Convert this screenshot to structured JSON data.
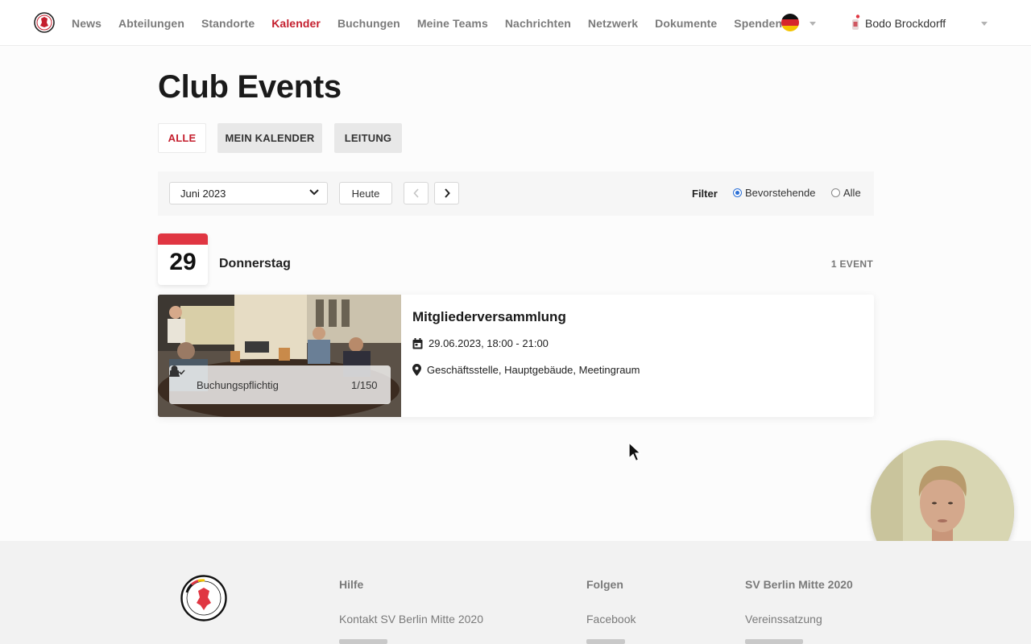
{
  "nav": {
    "items": [
      {
        "label": "News",
        "active": false
      },
      {
        "label": "Abteilungen",
        "active": false
      },
      {
        "label": "Standorte",
        "active": false
      },
      {
        "label": "Kalender",
        "active": true
      },
      {
        "label": "Buchungen",
        "active": false
      },
      {
        "label": "Meine Teams",
        "active": false
      },
      {
        "label": "Nachrichten",
        "active": false
      },
      {
        "label": "Netzwerk",
        "active": false
      },
      {
        "label": "Dokumente",
        "active": false
      },
      {
        "label": "Spenden",
        "active": false
      }
    ],
    "language_icon": "german-flag-icon",
    "user_name": "Bodo Brockdorff"
  },
  "page": {
    "title": "Club Events",
    "tabs": [
      "ALLE",
      "MEIN KALENDER",
      "LEITUNG"
    ],
    "active_tab": "ALLE"
  },
  "toolbar": {
    "month_value": "Juni 2023",
    "today_label": "Heute",
    "filter_label": "Filter",
    "filter_options": [
      "Bevorstehende",
      "Alle"
    ],
    "filter_selected": "Bevorstehende"
  },
  "day": {
    "number": "29",
    "name": "Donnerstag",
    "count_label": "1 EVENT"
  },
  "event": {
    "title": "Mitgliederversammlung",
    "datetime": "29.06.2023, 18:00 - 21:00",
    "location": "Geschäftsstelle, Hauptgebäude, Meetingraum",
    "booking_label": "Buchungspflichtig",
    "capacity": "1/150"
  },
  "footer": {
    "col1": {
      "heading": "Hilfe",
      "link": "Kontakt SV Berlin Mitte 2020"
    },
    "col2": {
      "heading": "Folgen",
      "link": "Facebook"
    },
    "col3": {
      "heading": "SV Berlin Mitte 2020",
      "link": "Vereinssatzung"
    },
    "logo_text": "SV BERLIN MITTE 2020"
  },
  "colors": {
    "accent": "#c41f2e",
    "calendar_red": "#e03642",
    "radio_blue": "#2b6fd6"
  }
}
